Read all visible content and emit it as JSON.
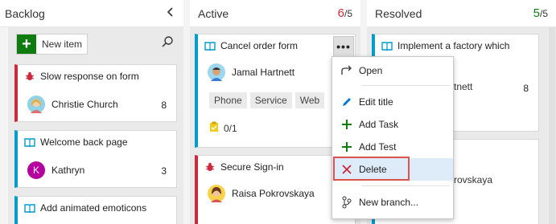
{
  "columns": {
    "backlog": {
      "title": "Backlog"
    },
    "active": {
      "title": "Active",
      "count": "6",
      "limit": "/5",
      "count_color": "#cc293d"
    },
    "resolved": {
      "title": "Resolved",
      "count": "5",
      "limit": "/5",
      "count_color": "#107c10"
    }
  },
  "backlog": {
    "new_item_label": "New item",
    "cards": [
      {
        "type": "bug",
        "title": "Slow response on form",
        "assignee": "Christie Church",
        "effort": "8"
      },
      {
        "type": "story",
        "title": "Welcome back page",
        "assignee": "Kathryn",
        "avatar_initial": "K",
        "effort": "3"
      },
      {
        "type": "story",
        "title": "Add animated emoticons"
      }
    ]
  },
  "active": {
    "cards": [
      {
        "type": "story",
        "title": "Cancel order form",
        "assignee": "Jamal Hartnett",
        "tags": [
          "Phone",
          "Service",
          "Web"
        ],
        "tasks": "0/1"
      },
      {
        "type": "bug",
        "title": "Secure Sign-in",
        "assignee": "Raisa Pokrovskaya"
      }
    ]
  },
  "resolved": {
    "cards": [
      {
        "type": "story",
        "title": "Implement a factory which",
        "assignee_fragment": "tnett",
        "effort": "8"
      },
      {
        "type": "story",
        "assignee_fragment": "rovskaya"
      }
    ]
  },
  "context_menu": {
    "items": [
      "Open",
      "Edit title",
      "Add Task",
      "Add Test",
      "Delete",
      "New branch..."
    ],
    "highlighted": "Delete",
    "highlight_color": "#d9534f"
  },
  "colors": {
    "bug": "#cc293d",
    "story": "#009ccc",
    "add": "#107c10",
    "menu_selected_bg": "#deecf9"
  }
}
